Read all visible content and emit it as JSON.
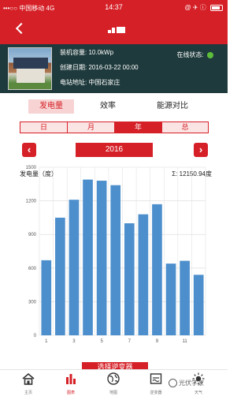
{
  "status_bar": {
    "carrier": "•••○○ 中国移动  4G",
    "time": "14:37",
    "icons": "@ ✈ ⓘ"
  },
  "station": {
    "capacity_label": "装机容量:",
    "capacity": "10.0kWp",
    "created_label": "创建日期:",
    "created": "2016-03-22 00:00",
    "address_label": "电站地址:",
    "address": "中国石家庄",
    "online_label": "在线状态:"
  },
  "metric_tabs": [
    {
      "label": "发电量",
      "active": true
    },
    {
      "label": "效率",
      "active": false
    },
    {
      "label": "能源对比",
      "active": false
    }
  ],
  "period_tabs": [
    {
      "label": "日",
      "active": false
    },
    {
      "label": "月",
      "active": false
    },
    {
      "label": "年",
      "active": true
    },
    {
      "label": "总",
      "active": false
    }
  ],
  "year": {
    "prev": "‹",
    "value": "2016",
    "next": "›"
  },
  "gen_label": "发电量（度）",
  "total": "Σ: 12150.94度",
  "select_site_label": "选择逆变器",
  "colors": {
    "accent": "#d52027",
    "bar": "#4d8fcc",
    "panel": "#1f3a3c",
    "online": "#5cbd3b"
  },
  "chart_data": {
    "type": "bar",
    "categories": [
      "1",
      "2",
      "3",
      "4",
      "5",
      "6",
      "7",
      "8",
      "9",
      "10",
      "11",
      "12"
    ],
    "values": [
      670,
      1050,
      1210,
      1390,
      1380,
      1340,
      1000,
      1080,
      1170,
      640,
      665,
      540
    ],
    "ylabel": "发电量（度）",
    "ylim": [
      0,
      1500
    ],
    "yticks": [
      0,
      300,
      600,
      900,
      1200,
      1500
    ],
    "xticks": [
      "1",
      "3",
      "5",
      "7",
      "9",
      "11"
    ],
    "grid": true
  },
  "tabbar": [
    {
      "label": "主页",
      "icon": "home-icon",
      "active": false
    },
    {
      "label": "图表",
      "icon": "bar-chart-icon",
      "active": true
    },
    {
      "label": "地图",
      "icon": "globe-icon",
      "active": false
    },
    {
      "label": "逆变器",
      "icon": "inverter-icon",
      "active": false
    },
    {
      "label": "天气",
      "icon": "weather-icon",
      "active": false
    }
  ],
  "watermark": "光伏学家"
}
